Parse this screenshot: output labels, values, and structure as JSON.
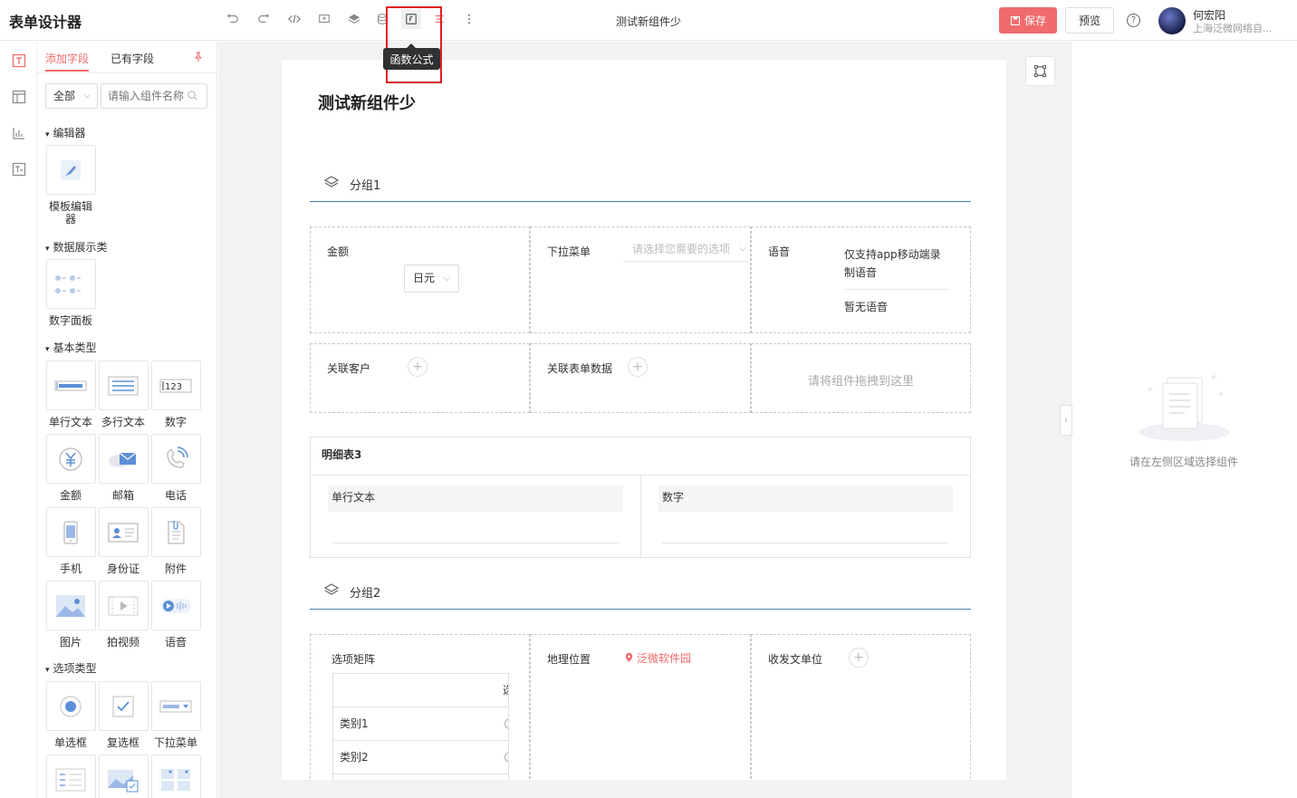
{
  "header": {
    "app_title": "表单设计器",
    "form_name": "测试新组件少",
    "tooltip": "函数公式",
    "save_label": "保存",
    "preview_label": "预览",
    "help_label": "?",
    "user_name": "何宏阳",
    "user_org": "上海泛微网络自..."
  },
  "panel": {
    "tabs": [
      "添加字段",
      "已有字段"
    ],
    "filter_value": "全部",
    "search_placeholder": "请输入组件名称",
    "categories": {
      "editor": "编辑器",
      "display": "数据展示类",
      "basic": "基本类型",
      "option": "选项类型"
    },
    "components": {
      "template_editor": "模板编辑器",
      "number_panel": "数字面板",
      "single_text": "单行文本",
      "multi_text": "多行文本",
      "number": "数字",
      "amount": "金额",
      "email": "邮箱",
      "phone": "电话",
      "mobile": "手机",
      "id_card": "身份证",
      "attachment": "附件",
      "image": "图片",
      "video": "拍视频",
      "voice": "语音",
      "radio": "单选框",
      "checkbox": "复选框",
      "dropdown": "下拉菜单"
    }
  },
  "canvas": {
    "title": "测试新组件少",
    "group1": "分组1",
    "group2": "分组2",
    "fields": {
      "amount_label": "金额",
      "amount_unit": "日元",
      "dropdown_label": "下拉菜单",
      "dropdown_placeholder": "请选择您需要的选项",
      "voice_label": "语音",
      "voice_note": "仅支持app移动端录制语音",
      "voice_empty": "暂无语音",
      "customer_label": "关联客户",
      "related_form_label": "关联表单数据",
      "drop_hint": "请将组件拖拽到这里",
      "matrix_label": "选项矩阵",
      "matrix_header_fragment": "选",
      "matrix_rows": [
        "类别1",
        "类别2"
      ],
      "geo_label": "地理位置",
      "geo_value": "泛微软件园",
      "doc_unit_label": "收发文单位"
    },
    "detail_table": {
      "title": "明细表3",
      "col1": "单行文本",
      "col2": "数字"
    }
  },
  "right_panel": {
    "empty_text": "请在左侧区域选择组件"
  },
  "colors": {
    "accent": "#f06b6b",
    "group_line": "#4a7fb0",
    "highlight": "#e02020"
  }
}
